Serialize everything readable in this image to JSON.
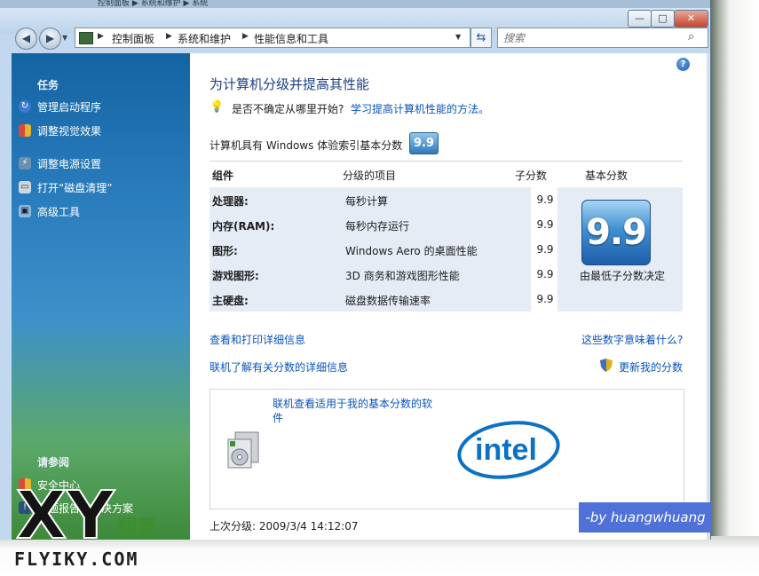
{
  "top_strip": "控制面板 ▶ 系统和维护 ▶ 系统",
  "window": {
    "buttons": {
      "minimize": "—",
      "maximize": "□",
      "close": "✕"
    }
  },
  "address": {
    "crumbs": [
      "控制面板",
      "系统和维护",
      "性能信息和工具"
    ],
    "search_placeholder": "搜索"
  },
  "left_panel": {
    "tasks_heading": "任务",
    "tasks": [
      {
        "label": "管理启动程序",
        "icon": "manage-startup-icon"
      },
      {
        "label": "调整视觉效果",
        "icon": "shield-icon"
      },
      {
        "label": "调整电源设置",
        "icon": "power-icon"
      },
      {
        "label": "打开“磁盘清理”",
        "icon": "disk-cleanup-icon"
      },
      {
        "label": "高级工具",
        "icon": "advanced-tools-icon"
      }
    ],
    "see_also_heading": "请参阅",
    "see_also": [
      "安全中心",
      "问题报告和解决方案"
    ]
  },
  "content": {
    "title": "为计算机分级并提高其性能",
    "hint_text": "是否不确定从哪里开始?",
    "hint_link": "学习提高计算机性能的方法。",
    "base_text": "计算机具有 Windows 体验索引基本分数",
    "base_score": "9.9",
    "table": {
      "headers": [
        "组件",
        "分级的项目",
        "子分数",
        "基本分数"
      ],
      "rows": [
        {
          "component": "处理器:",
          "item": "每秒计算",
          "score": "9.9"
        },
        {
          "component": "内存(RAM):",
          "item": "每秒内存运行",
          "score": "9.9"
        },
        {
          "component": "图形:",
          "item": "Windows Aero 的桌面性能",
          "score": "9.9"
        },
        {
          "component": "游戏图形:",
          "item": "3D 商务和游戏图形性能",
          "score": "9.9"
        },
        {
          "component": "主硬盘:",
          "item": "磁盘数据传输速率",
          "score": "9.9"
        }
      ],
      "base_caption": "由最低子分数决定"
    },
    "links": {
      "print_details": "查看和打印详细信息",
      "what_mean": "这些数字意味着什么?",
      "online_details": "联机了解有关分数的详细信息",
      "update_score": "更新我的分数"
    },
    "software": {
      "link": "联机查看适用于我的基本分数的软件",
      "logo_text": "intel"
    },
    "last_rating": "上次分级: 2009/3/4 14:12:07"
  },
  "watermarks": {
    "by": "-by huangwhuang",
    "brand_text": "FLYIKY.COM",
    "brand_cn": "翔意",
    "brand_mark": "XY"
  },
  "colors": {
    "link": "#0a53be",
    "title": "#1c3f86",
    "table_bg": "#e5ecf6",
    "panel_top": "#1463a3"
  }
}
